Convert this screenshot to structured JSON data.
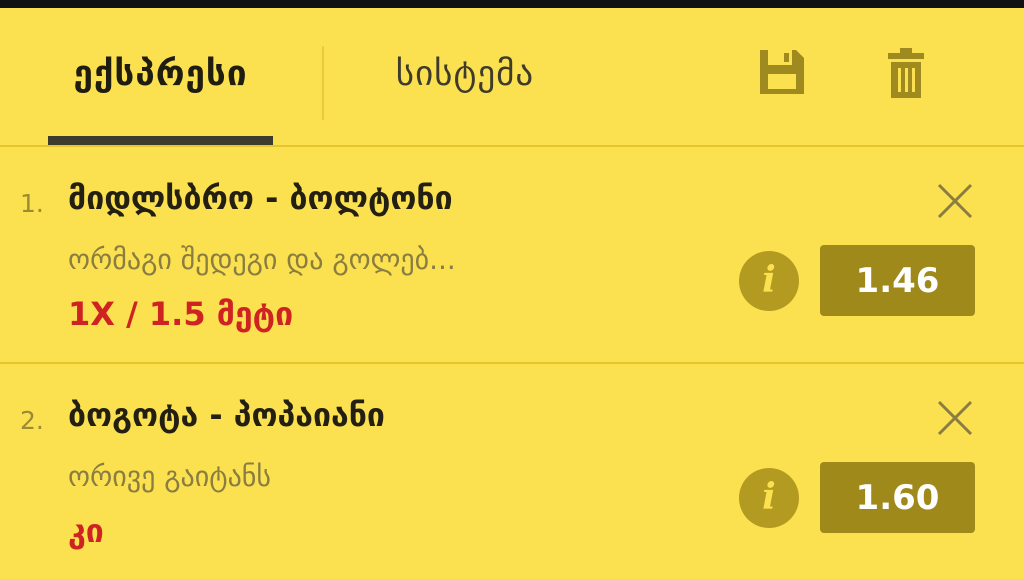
{
  "tabs": {
    "express_label": "ექსპრესი",
    "system_label": "სისტემა"
  },
  "toolbar": {
    "save_icon": "save-icon",
    "delete_icon": "trash-icon"
  },
  "colors": {
    "background": "#fbe04f",
    "accent_dark": "#3d3a2e",
    "pick_red": "#cf2323",
    "odds_bg": "#a0891b"
  },
  "bets": [
    {
      "number": "1.",
      "title": "მიდლსბრო - ბოლტონი",
      "market": "ორმაგი შედეგი და გოლებ...",
      "pick": "1X / 1.5 მეტი",
      "odds": "1.46"
    },
    {
      "number": "2.",
      "title": "ბოგოტა - პოპაიანი",
      "market": "ორივე გაიტანს",
      "pick": "კი",
      "odds": "1.60"
    }
  ]
}
